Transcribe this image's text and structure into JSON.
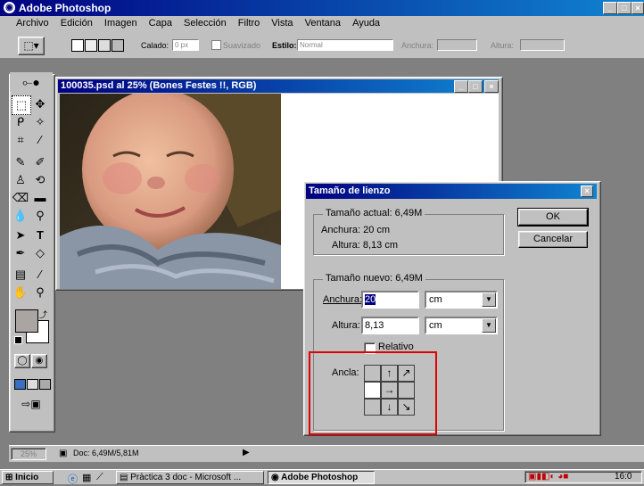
{
  "app": {
    "title": "Adobe Photoshop"
  },
  "menu": [
    "Archivo",
    "Edición",
    "Imagen",
    "Capa",
    "Selección",
    "Filtro",
    "Vista",
    "Ventana",
    "Ayuda"
  ],
  "options": {
    "feather_label": "Calado:",
    "feather_value": "0 px",
    "antialias_label": "Suavizado",
    "style_label": "Estilo:",
    "style_value": "Normal",
    "width_label": "Anchura:",
    "height_label": "Altura:"
  },
  "document": {
    "title": "100035.psd al 25% (Bones Festes !!, RGB)"
  },
  "dialog": {
    "title": "Tamaño de lienzo",
    "current_size_label": "Tamaño actual: 6,49M",
    "current_width": "Anchura: 20 cm",
    "current_height": "Altura: 8,13 cm",
    "new_size_label": "Tamaño nuevo: 6,49M",
    "width_label": "Anchura:",
    "width_value": "20",
    "width_unit": "cm",
    "height_label": "Altura:",
    "height_value": "8,13",
    "height_unit": "cm",
    "relative_label": "Relativo",
    "anchor_label": "Ancla:",
    "ok_label": "OK",
    "cancel_label": "Cancelar"
  },
  "status": {
    "zoom": "25%",
    "doc_info": "Doc: 6,49M/5,81M"
  },
  "taskbar": {
    "start_label": "Inicio",
    "task_word": "Pràctica 3 doc - Microsoft ...",
    "task_ps": "Adobe Photoshop",
    "clock": "16:0"
  },
  "colors": {
    "titlebar": "#000080",
    "chrome": "#c0c0c0",
    "highlight": "#e00000"
  }
}
